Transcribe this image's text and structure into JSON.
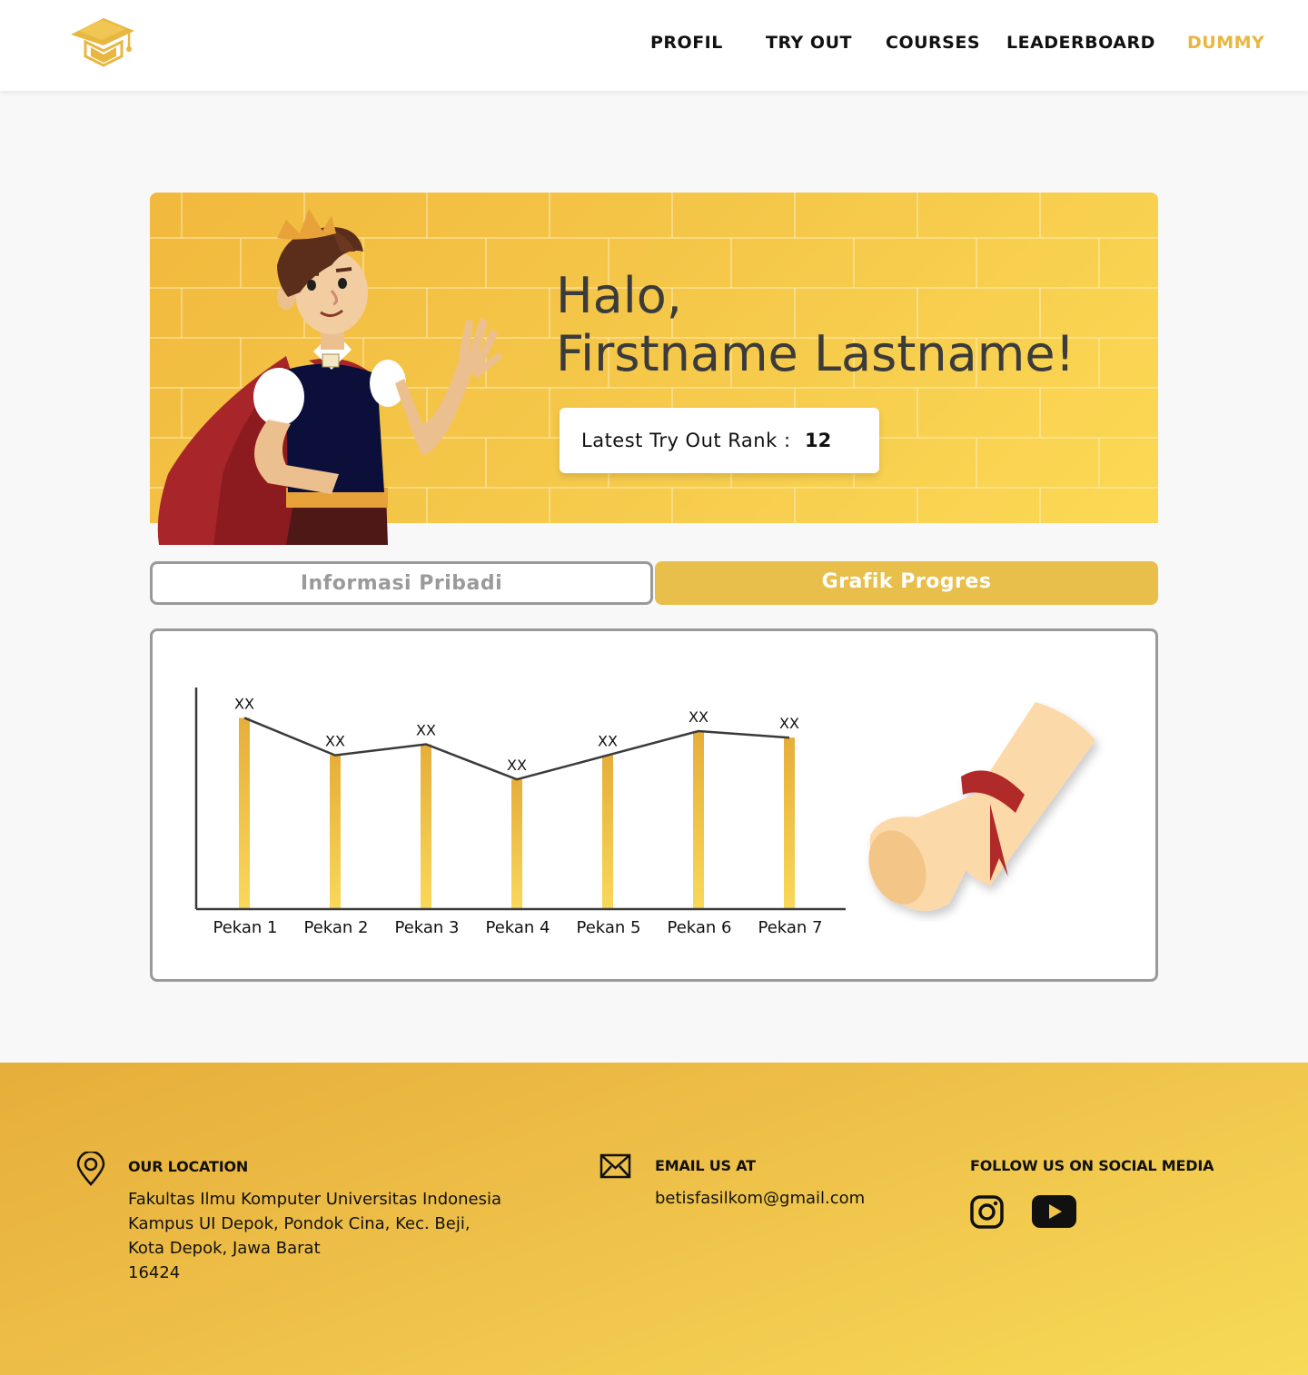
{
  "header": {
    "nav": [
      {
        "label": "PROFIL"
      },
      {
        "label": "TRY OUT"
      },
      {
        "label": "COURSES"
      },
      {
        "label": "LEADERBOARD"
      },
      {
        "label": "DUMMY",
        "active": true
      }
    ]
  },
  "hero": {
    "greeting_line1": "Halo,",
    "greeting_line2": "Firstname Lastname!",
    "rank_label": "Latest Try Out Rank :",
    "rank_value": "12"
  },
  "tabs": {
    "info_label": "Informasi Pribadi",
    "grafik_label": "Grafik Progres",
    "active": "grafik"
  },
  "chart_data": {
    "type": "bar",
    "categories": [
      "Pekan 1",
      "Pekan 2",
      "Pekan 3",
      "Pekan 4",
      "Pekan 5",
      "Pekan 6",
      "Pekan 7"
    ],
    "values": [
      87,
      70,
      75,
      59,
      70,
      81,
      78
    ],
    "data_labels": [
      "XX",
      "XX",
      "XX",
      "XX",
      "XX",
      "XX",
      "XX"
    ],
    "overlay_line": true,
    "ylim": [
      0,
      100
    ],
    "title": "",
    "xlabel": "",
    "ylabel": "",
    "colors": {
      "bar": "#f2c23e",
      "line": "#3a3a3a",
      "axis": "#3a3a3a"
    }
  },
  "footer": {
    "location": {
      "title": "OUR LOCATION",
      "lines": [
        "Fakultas Ilmu Komputer Universitas Indonesia",
        "Kampus UI Depok, Pondok Cina, Kec. Beji,",
        "Kota Depok, Jawa Barat",
        "16424"
      ]
    },
    "email": {
      "title": "EMAIL US AT",
      "address": "betisfasilkom@gmail.com"
    },
    "social": {
      "title": "FOLLOW US ON SOCIAL MEDIA",
      "icons": [
        "instagram-icon",
        "youtube-icon"
      ]
    }
  },
  "colors": {
    "accent": "#e8b73f",
    "tab_active": "#e8bf4a",
    "hero_yellow": "#f5c84a"
  }
}
